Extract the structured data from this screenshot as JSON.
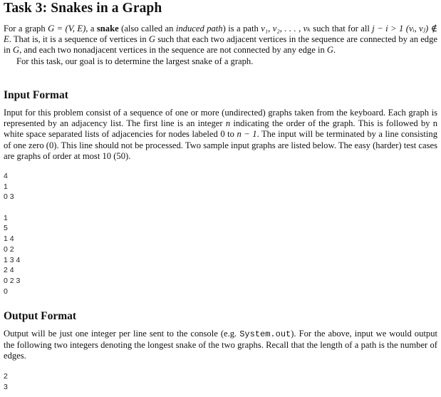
{
  "title": "Task 3: Snakes in a Graph",
  "intro": {
    "p1_parts": [
      "For a graph ",
      "G = (V, E)",
      ", a ",
      "snake",
      " (also called an ",
      "induced path",
      ") is a path ",
      "v₁, v₂, . . . , vₖ",
      " such that for all ",
      "j − i > 1",
      " ",
      "(vᵢ, vⱼ) ∉ E",
      ". That is, it is a sequence of vertices in ",
      "G",
      " such that each two adjacent vertices in the sequence are connected by an edge in ",
      "G",
      ", and each two nonadjacent vertices in the sequence are not connected by any edge in ",
      "G",
      "."
    ],
    "p2": "For this task, our goal is to determine the largest snake of a graph."
  },
  "input_format": {
    "heading": "Input Format",
    "parts": [
      "Input for this problem consist of a sequence of one or more (undirected) graphs taken from the keyboard. Each graph is represented by an adjacency list. The first line is an integer ",
      "n",
      " indicating the order of the graph. This is followed by n white space separated lists of adjacencies for nodes labeled 0 to ",
      "n − 1",
      ". The input will be terminated by a line consisting of one zero (0). This line should not be processed. Two sample input graphs are listed below. The easy (harder) test cases are graphs of order at most 10 (50)."
    ],
    "sample_lines": [
      "4",
      "1",
      "0 3",
      "",
      "1",
      "5",
      "1 4",
      "0 2",
      "1 3 4",
      "2 4",
      "0 2 3",
      "0"
    ]
  },
  "output_format": {
    "heading": "Output Format",
    "parts": [
      "Output will be just one integer per line sent to the console (e.g. ",
      "System.out",
      "). For the above, input we would output the following two integers denoting the longest snake of the two graphs. Recall that the length of a path is the number of edges."
    ],
    "sample_lines": [
      "2",
      "3"
    ]
  }
}
